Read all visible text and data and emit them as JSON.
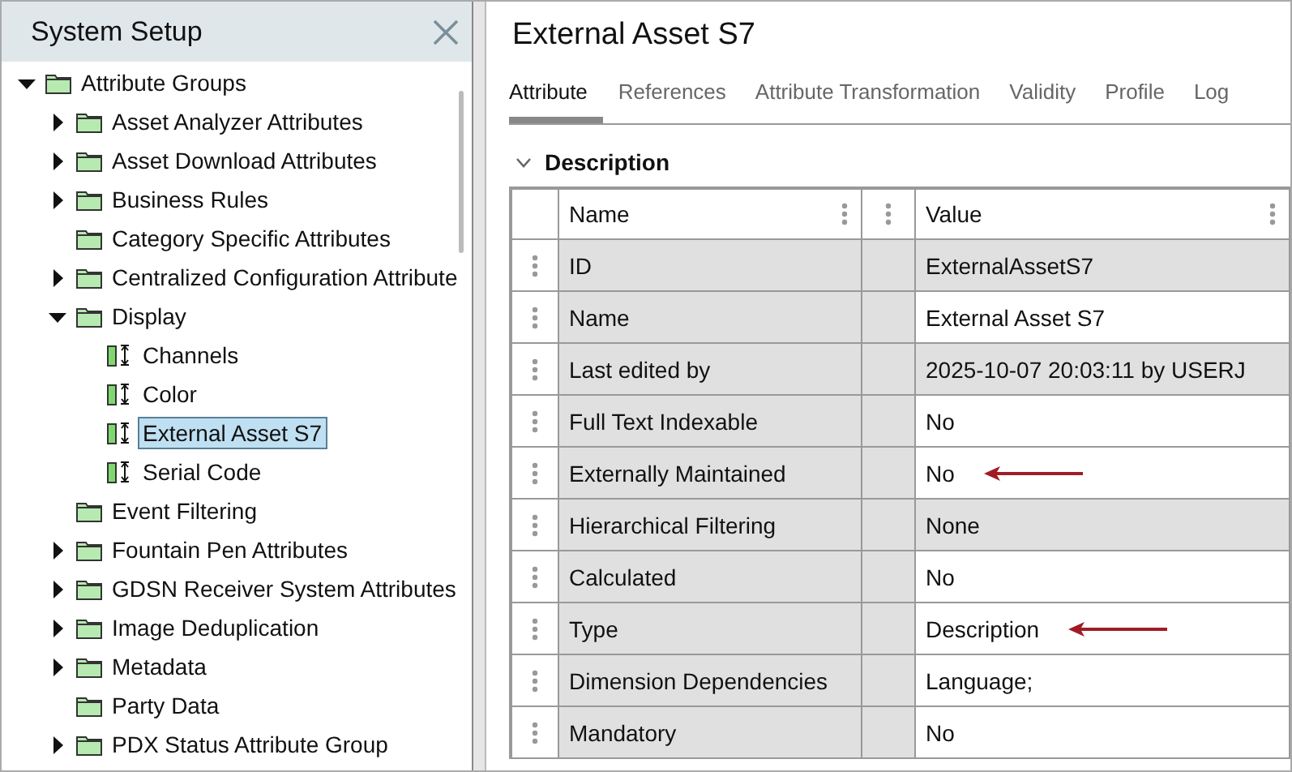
{
  "sidebar": {
    "title": "System Setup",
    "tree": [
      {
        "label": "Attribute Groups",
        "kind": "folder",
        "expandable": true,
        "expanded": true,
        "selected": false,
        "children": [
          {
            "label": "Asset Analyzer Attributes",
            "kind": "folder",
            "expandable": true,
            "expanded": false,
            "selected": false
          },
          {
            "label": "Asset Download Attributes",
            "kind": "folder",
            "expandable": true,
            "expanded": false,
            "selected": false
          },
          {
            "label": "Business Rules",
            "kind": "folder",
            "expandable": true,
            "expanded": false,
            "selected": false
          },
          {
            "label": "Category Specific Attributes",
            "kind": "folder",
            "expandable": false,
            "expanded": false,
            "selected": false
          },
          {
            "label": "Centralized Configuration Attribute",
            "kind": "folder",
            "expandable": true,
            "expanded": false,
            "selected": false
          },
          {
            "label": "Display",
            "kind": "folder",
            "expandable": true,
            "expanded": true,
            "selected": false,
            "children": [
              {
                "label": "Channels",
                "kind": "attribute",
                "expandable": false,
                "expanded": false,
                "selected": false
              },
              {
                "label": "Color",
                "kind": "attribute",
                "expandable": false,
                "expanded": false,
                "selected": false
              },
              {
                "label": "External Asset S7",
                "kind": "attribute",
                "expandable": false,
                "expanded": false,
                "selected": true
              },
              {
                "label": "Serial Code",
                "kind": "attribute",
                "expandable": false,
                "expanded": false,
                "selected": false
              }
            ]
          },
          {
            "label": "Event Filtering",
            "kind": "folder",
            "expandable": false,
            "expanded": false,
            "selected": false
          },
          {
            "label": "Fountain Pen Attributes",
            "kind": "folder",
            "expandable": true,
            "expanded": false,
            "selected": false
          },
          {
            "label": "GDSN Receiver System Attributes",
            "kind": "folder",
            "expandable": true,
            "expanded": false,
            "selected": false
          },
          {
            "label": "Image Deduplication",
            "kind": "folder",
            "expandable": true,
            "expanded": false,
            "selected": false
          },
          {
            "label": "Metadata",
            "kind": "folder",
            "expandable": true,
            "expanded": false,
            "selected": false
          },
          {
            "label": "Party Data",
            "kind": "folder",
            "expandable": false,
            "expanded": false,
            "selected": false
          },
          {
            "label": "PDX Status Attribute Group",
            "kind": "folder",
            "expandable": true,
            "expanded": false,
            "selected": false
          }
        ]
      }
    ]
  },
  "main": {
    "title": "External Asset S7",
    "tabs": [
      {
        "label": "Attribute",
        "selected": true
      },
      {
        "label": "References",
        "selected": false
      },
      {
        "label": "Attribute Transformation",
        "selected": false
      },
      {
        "label": "Validity",
        "selected": false
      },
      {
        "label": "Profile",
        "selected": false
      },
      {
        "label": "Log",
        "selected": false
      }
    ],
    "section": {
      "title": "Description",
      "expanded": true
    },
    "table": {
      "columns": [
        "Name",
        "Value"
      ],
      "rows": [
        {
          "name": "ID",
          "value": "ExternalAssetS7",
          "readonly": true,
          "arrow": false
        },
        {
          "name": "Name",
          "value": "External Asset S7",
          "readonly": false,
          "arrow": false
        },
        {
          "name": "Last edited by",
          "value": "2025-10-07 20:03:11 by USERJ",
          "readonly": true,
          "arrow": false
        },
        {
          "name": "Full Text Indexable",
          "value": "No",
          "readonly": false,
          "arrow": false
        },
        {
          "name": "Externally Maintained",
          "value": "No",
          "readonly": false,
          "arrow": true
        },
        {
          "name": "Hierarchical Filtering",
          "value": "None",
          "readonly": true,
          "arrow": false
        },
        {
          "name": "Calculated",
          "value": "No",
          "readonly": false,
          "arrow": false
        },
        {
          "name": "Type",
          "value": "Description",
          "readonly": false,
          "arrow": true
        },
        {
          "name": "Dimension Dependencies",
          "value": "Language;",
          "readonly": false,
          "arrow": false
        },
        {
          "name": "Mandatory",
          "value": "No",
          "readonly": false,
          "arrow": false
        }
      ]
    }
  }
}
